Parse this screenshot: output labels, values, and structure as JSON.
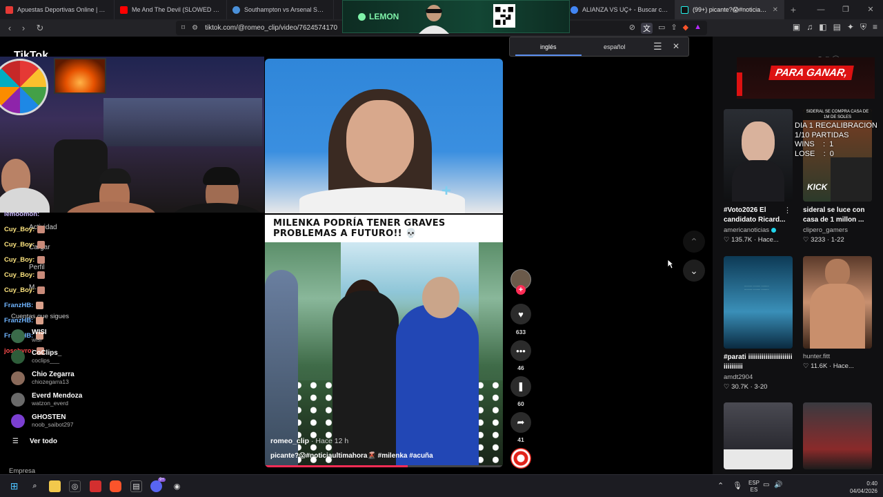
{
  "browser": {
    "tabs": [
      {
        "title": "Apuestas Deportivas Online | Apuest",
        "color": "#e53935"
      },
      {
        "title": "Me And The Devil (SLOWED + ECO)",
        "color": "#ff0000"
      },
      {
        "title": "Southampton vs Arsenal SCORES24",
        "color": "#4a90d9"
      },
      {
        "title": "ALIANZA VS UÇ+ - Buscar con Goog",
        "color": "#4285f4"
      },
      {
        "title": "(99+) picante?😱#noticiaulti",
        "color": "#25f4ee"
      }
    ],
    "url": "tiktok.com/@romeo_clip/video/7624574170",
    "new_tab_glyph": "+"
  },
  "ad": {
    "brand": "LEMON"
  },
  "translate": {
    "lang_from": "inglés",
    "lang_to": "español"
  },
  "page": {
    "logo_text": "TikTok",
    "chat": [
      {
        "user": "lemoomon:",
        "color": "#c9b8ff"
      },
      {
        "user": "Cuy_Boy:",
        "color": "#ffe680"
      },
      {
        "user": "Cuy_Boy:",
        "color": "#ffe680"
      },
      {
        "user": "Cuy_Boy:",
        "color": "#ffe680"
      },
      {
        "user": "Cuy_Boy:",
        "color": "#ffe680"
      },
      {
        "user": "Cuy_Boy:",
        "color": "#ffe680"
      },
      {
        "user": "FranzHB:",
        "color": "#6fb4ff"
      },
      {
        "user": "FranzHB:",
        "color": "#6fb4ff"
      },
      {
        "user": "FranzHB:",
        "color": "#6fb4ff"
      },
      {
        "user": "josebyro:",
        "color": "#ff4d4d"
      }
    ],
    "sidebar_behind": {
      "actividad": "Actividad",
      "cargar": "Cargar",
      "perfil": "Perfil",
      "more": "M...",
      "following_header": "Cuentas que sigues"
    },
    "following": [
      {
        "name": "WISI",
        "handle": "wisi",
        "color": "#3a6b4a"
      },
      {
        "name": "CoClips_",
        "handle": "coclips___",
        "color": "#2e5d3a"
      },
      {
        "name": "Chio Zegarra",
        "handle": "chiozegarra13",
        "color": "#8a6a5a"
      },
      {
        "name": "Everd Mendoza",
        "handle": "watzon_everd",
        "color": "#6a6a6a"
      },
      {
        "name": "GHOSTEN",
        "handle": "noob_saibot297",
        "color": "#7b3fd1"
      }
    ],
    "see_all": "Ver todo",
    "empresa": "Empresa"
  },
  "video": {
    "banner": "MILENKA PODRÍA TENER GRAVES PROBLEMAS A FUTURO!! 💀",
    "author": "romeo_clip",
    "time": "· Hace 12 h",
    "caption": "picante?😱#noticiaultimahora🌋 #milenka #acuña",
    "progress": 0.6,
    "likes": "633",
    "comments": "46",
    "saves": "60",
    "shares": "41"
  },
  "right": {
    "promo_text": "PARA GANAR,",
    "stream_overlay": "DIA 1 RECALIBRACION\n1/10 PARTIDAS\nWINS    :  1\nLOSE    :  0",
    "cards": [
      {
        "title": "#Voto2026 El candidato Ricard...",
        "author": "americanoticias",
        "verified": true,
        "stats": "♡ 135.7K · Hace...",
        "bg": "linear-gradient(180deg,#2a2d33,#0f1012)"
      },
      {
        "title": "sideral se luce con casa de 1 millon ...",
        "author": "clipero_gamers",
        "verified": false,
        "stats": "♡ 3233 · 1-22",
        "bg": "linear-gradient(180deg,#7a3d22,#2c3a2a)",
        "thumb_text": "SIDERAL SE COMPRA CASA DE 1M DE SOLES",
        "badge": "KICK"
      },
      {
        "title": "#parati iiiiiiiiiiiiiiiiiiiiiii iiiiiiiiii",
        "author": "amdt2904",
        "verified": false,
        "stats": "♡ 30.7K · 3-20",
        "bg": "linear-gradient(180deg,#0d3a55,#3a8fb8 60%,#0a2a40)"
      },
      {
        "title": "",
        "author": "hunter.fitt",
        "verified": false,
        "stats": "♡ 11.6K · Hace...",
        "bg": "linear-gradient(180deg,#5b3a2a,#c89070 50%,#3a2418)"
      },
      {
        "title": "",
        "author": "",
        "verified": false,
        "stats": "",
        "bg": "linear-gradient(180deg,#4a4a52,#1c1c22)"
      },
      {
        "title": "",
        "author": "",
        "verified": false,
        "stats": "",
        "bg": "linear-gradient(180deg,#3a3a40,#8a2a2a 70%,#1c1c1c)"
      }
    ]
  },
  "taskbar": {
    "lang_top": "ESP",
    "lang_bot": "ES",
    "time": "0:40",
    "date": "04/04/2026",
    "badge": "9+"
  }
}
